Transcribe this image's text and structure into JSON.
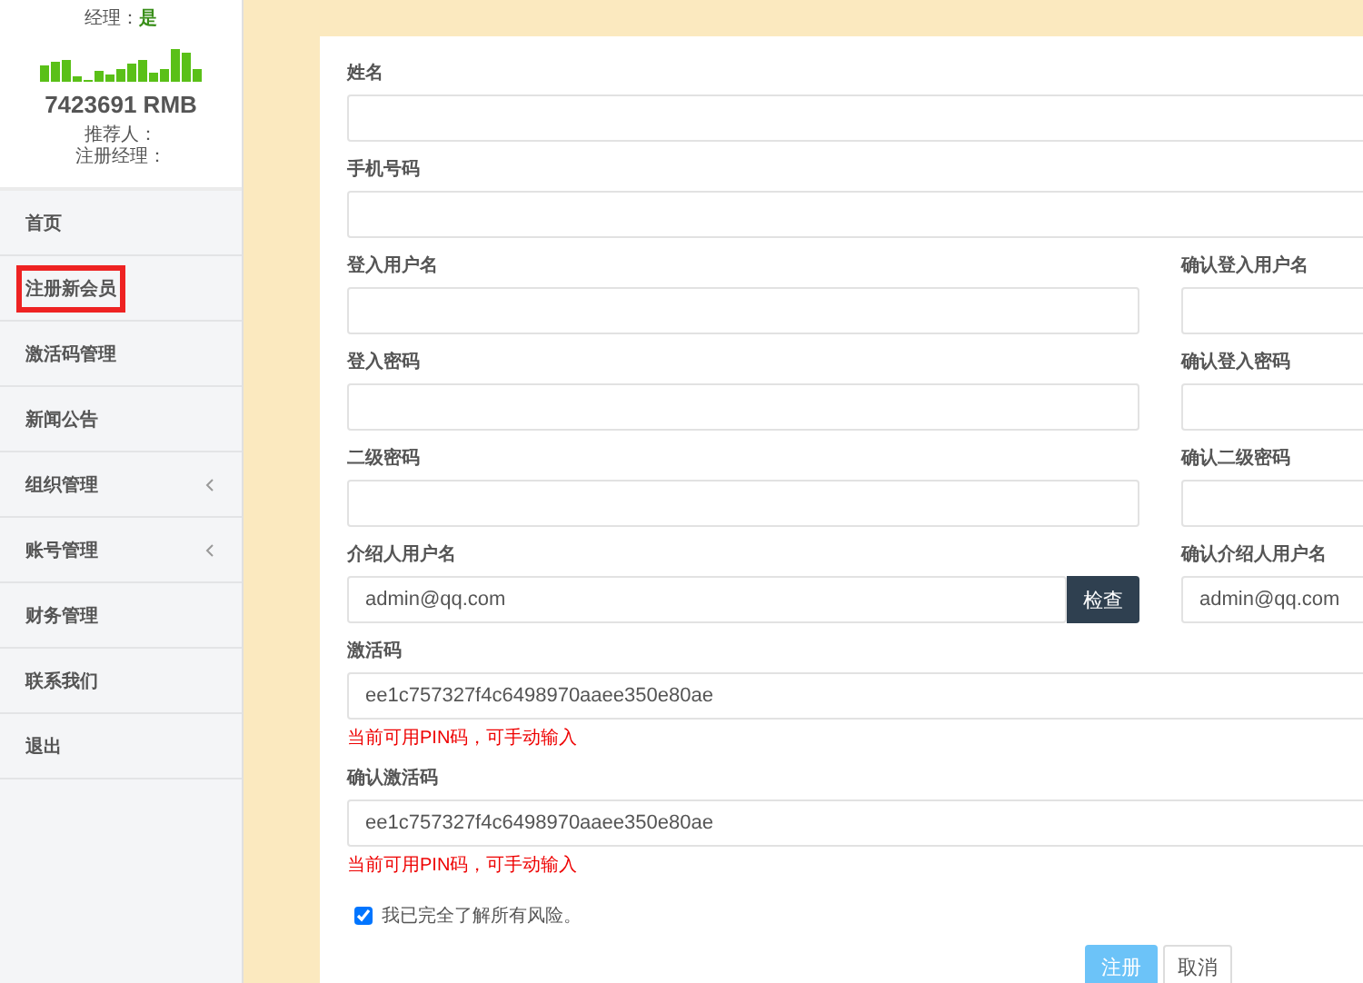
{
  "profile": {
    "manager_label": "经理：",
    "manager_value": "是",
    "balance": "7423691 RMB",
    "referrer_label": "推荐人：",
    "register_manager_label": "注册经理："
  },
  "menu": [
    {
      "label": "首页",
      "selected": false,
      "has_submenu": false
    },
    {
      "label": "注册新会员",
      "selected": true,
      "has_submenu": false
    },
    {
      "label": "激活码管理",
      "selected": false,
      "has_submenu": false
    },
    {
      "label": "新闻公告",
      "selected": false,
      "has_submenu": false
    },
    {
      "label": "组织管理",
      "selected": false,
      "has_submenu": true
    },
    {
      "label": "账号管理",
      "selected": false,
      "has_submenu": true
    },
    {
      "label": "财务管理",
      "selected": false,
      "has_submenu": false
    },
    {
      "label": "联系我们",
      "selected": false,
      "has_submenu": false
    },
    {
      "label": "退出",
      "selected": false,
      "has_submenu": false
    }
  ],
  "form": {
    "rows": [
      {
        "fields": [
          {
            "label": "姓名"
          }
        ]
      },
      {
        "fields": [
          {
            "label": "手机号码"
          }
        ]
      },
      {
        "fields": [
          {
            "label": "登入用户名"
          },
          {
            "label": "确认登入用户名"
          }
        ]
      },
      {
        "fields": [
          {
            "label": "登入密码"
          },
          {
            "label": "确认登入密码"
          }
        ]
      },
      {
        "fields": [
          {
            "label": "二级密码"
          },
          {
            "label": "确认二级密码"
          }
        ]
      },
      {
        "fields": [
          {
            "label": "介绍人用户名",
            "value": "admin@qq.com",
            "button": "检查"
          },
          {
            "label": "确认介绍人用户名",
            "value": "admin@qq.com"
          }
        ]
      },
      {
        "fields": [
          {
            "label": "激活码",
            "value": "ee1c757327f4c6498970aaee350e80ae",
            "hint": "当前可用PIN码，可手动输入"
          }
        ]
      },
      {
        "fields": [
          {
            "label": "确认激活码",
            "value": "ee1c757327f4c6498970aaee350e80ae",
            "hint": "当前可用PIN码，可手动输入"
          }
        ]
      }
    ],
    "agreement": {
      "label": "我已完全了解所有风险。",
      "checked": true
    },
    "submit": "注册",
    "cancel": "取消"
  }
}
